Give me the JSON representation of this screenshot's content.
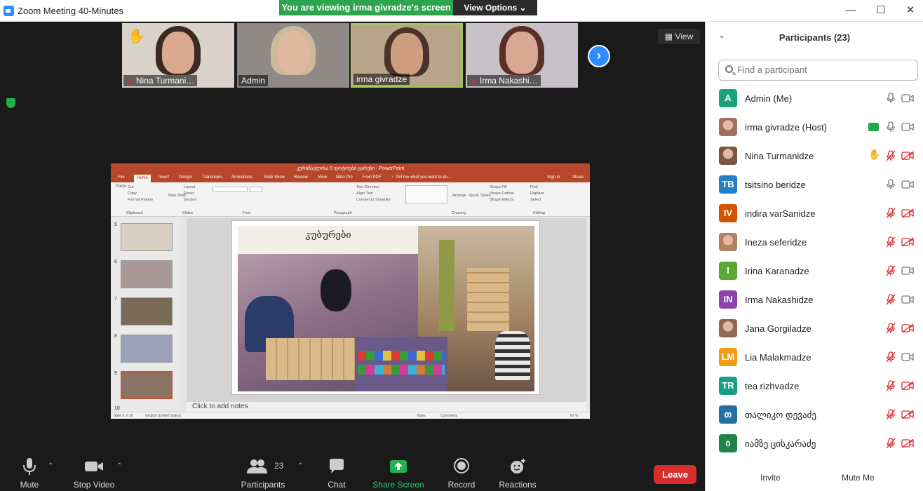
{
  "window": {
    "title": "Zoom Meeting 40-Minutes"
  },
  "banner": {
    "text": "You are viewing irma givradze's screen",
    "view_options": "View Options ⌄"
  },
  "view_button": "▦ View",
  "thumbnails": [
    {
      "label": "Nina Turmani…",
      "muted": true,
      "hand": true
    },
    {
      "label": "Admin",
      "muted": false,
      "hand": false
    },
    {
      "label": "irma givradze",
      "muted": false,
      "hand": false,
      "active": true
    },
    {
      "label": "Irma Nakashi…",
      "muted": true,
      "hand": false
    }
  ],
  "shared_screen": {
    "app_title": "კურსწავლისა 5 ფოტოები ცარები - PowerPoint",
    "tabs": [
      "File",
      "Home",
      "Insert",
      "Design",
      "Transitions",
      "Animations",
      "Slide Show",
      "Review",
      "View",
      "Nitro Pro",
      "Foxit PDF",
      "♀ Tell me what you want to do..."
    ],
    "account": "Sign in",
    "share": "Share",
    "ribbon_groups": [
      "Clipboard",
      "Slides",
      "Font",
      "Paragraph",
      "Drawing",
      "Editing"
    ],
    "ribbon_items": [
      "Cut",
      "Copy",
      "Format Painter",
      "Paste",
      "New Slide",
      "Layout",
      "Reset",
      "Section",
      "Text Direction",
      "Align Text",
      "Convert to SmartArt",
      "Arrange",
      "Quick Styles",
      "Shape Fill",
      "Shape Outline",
      "Shape Effects",
      "Find",
      "Replace",
      "Select"
    ],
    "slide_numbers": [
      "5",
      "6",
      "7",
      "8",
      "9",
      "10"
    ],
    "slide_title": "კუბურები",
    "notes_placeholder": "Click to add notes",
    "status_left": "Slide 9 of 36",
    "status_lang": "English (United States)",
    "status_notes": "Notes",
    "status_comments": "Comments",
    "zoom_level": "69 %"
  },
  "toolbar": {
    "mute": "Mute",
    "stop_video": "Stop Video",
    "participants": "Participants",
    "participants_count": "23",
    "chat": "Chat",
    "share_screen": "Share Screen",
    "record": "Record",
    "reactions": "Reactions",
    "leave": "Leave"
  },
  "panel": {
    "title": "Participants (23)",
    "search_placeholder": "Find a participant",
    "invite": "Invite",
    "mute_me": "Mute Me",
    "participants": [
      {
        "name": "Admin (Me)",
        "initials": "A",
        "color": "#1aa37a",
        "photo": false,
        "mic": "on",
        "cam": "on",
        "share": false,
        "hand": false
      },
      {
        "name": "irma givradze (Host)",
        "initials": "",
        "color": "#a07060",
        "photo": true,
        "mic": "on",
        "cam": "on",
        "share": true,
        "hand": false
      },
      {
        "name": "Nina Turmanidze",
        "initials": "",
        "color": "#7a5544",
        "photo": true,
        "mic": "off",
        "cam": "off",
        "share": false,
        "hand": true
      },
      {
        "name": "tsitsino beridze",
        "initials": "TB",
        "color": "#2380c3",
        "photo": false,
        "mic": "on",
        "cam": "on",
        "share": false,
        "hand": false
      },
      {
        "name": "indira varSanidze",
        "initials": "IV",
        "color": "#d35400",
        "photo": false,
        "mic": "off",
        "cam": "off",
        "share": false,
        "hand": false
      },
      {
        "name": "Ineza seferidze",
        "initials": "",
        "color": "#b08060",
        "photo": true,
        "mic": "off",
        "cam": "off",
        "share": false,
        "hand": false
      },
      {
        "name": "Irina Karanadze",
        "initials": "I",
        "color": "#5ba832",
        "photo": false,
        "mic": "off",
        "cam": "on",
        "share": false,
        "hand": false
      },
      {
        "name": "Irma Nakashidze",
        "initials": "IN",
        "color": "#8e44ad",
        "photo": false,
        "mic": "off",
        "cam": "on",
        "share": false,
        "hand": false
      },
      {
        "name": "Jana Gorgiladze",
        "initials": "",
        "color": "#906858",
        "photo": true,
        "mic": "off",
        "cam": "off",
        "share": false,
        "hand": false
      },
      {
        "name": "Lia Malakmadze",
        "initials": "LM",
        "color": "#f39c12",
        "photo": false,
        "mic": "off",
        "cam": "on",
        "share": false,
        "hand": false
      },
      {
        "name": "tea rizhvadze",
        "initials": "TR",
        "color": "#16a085",
        "photo": false,
        "mic": "off",
        "cam": "off",
        "share": false,
        "hand": false
      },
      {
        "name": "თალიკო დევაძე",
        "initials": "თ",
        "color": "#2471a3",
        "photo": false,
        "mic": "off",
        "cam": "off",
        "share": false,
        "hand": false
      },
      {
        "name": "იამზე ცისკარაძე",
        "initials": "ი",
        "color": "#1e8449",
        "photo": false,
        "mic": "off",
        "cam": "off",
        "share": false,
        "hand": false
      }
    ]
  }
}
